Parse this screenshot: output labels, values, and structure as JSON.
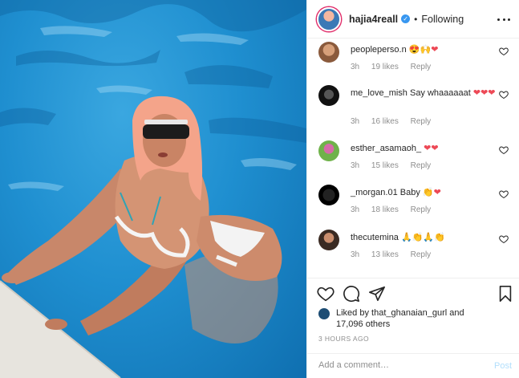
{
  "post": {
    "image_alt": "Woman with peach hair and sunglasses in a white bikini leaning on the edge of a blue swimming pool"
  },
  "header": {
    "username": "hajia4reall",
    "verified_mark": "✓",
    "separator": "•",
    "follow_status": "Following",
    "more_icon": "more-horizontal-icon"
  },
  "comments": [
    {
      "username": "peopleperso.n",
      "text": "",
      "emoji": "😍🙌❤",
      "time": "3h",
      "likes": "19 likes",
      "reply": "Reply"
    },
    {
      "username": "me_love_mish",
      "text": " Say whaaaaaat",
      "emoji": "❤❤❤",
      "time": "3h",
      "likes": "16 likes",
      "reply": "Reply"
    },
    {
      "username": "esther_asamaoh_",
      "text": "",
      "emoji": "❤❤",
      "time": "3h",
      "likes": "15 likes",
      "reply": "Reply"
    },
    {
      "username": "_morgan.01",
      "text": " Baby",
      "emoji": "👏❤",
      "time": "3h",
      "likes": "18 likes",
      "reply": "Reply"
    },
    {
      "username": "thecutemina",
      "text": "",
      "emoji": "🙏👏🙏👏",
      "time": "3h",
      "likes": "13 likes",
      "reply": "Reply"
    }
  ],
  "actions": {
    "like_icon": "heart-icon",
    "comment_icon": "comment-icon",
    "share_icon": "share-icon",
    "save_icon": "bookmark-icon"
  },
  "likes": {
    "prefix": "Liked by ",
    "user": "that_ghanaian_gurl",
    "suffix": " and",
    "others": "17,096 others"
  },
  "timestamp": "3 HOURS AGO",
  "add_comment": {
    "placeholder": "Add a comment…",
    "post_label": "Post"
  },
  "colors": {
    "pool_blue": "#1f8fd0",
    "link_blue": "#3897f0",
    "post_disabled": "#b2dffc",
    "heart_red": "#ed4956",
    "meta_gray": "#8e8e8e"
  }
}
